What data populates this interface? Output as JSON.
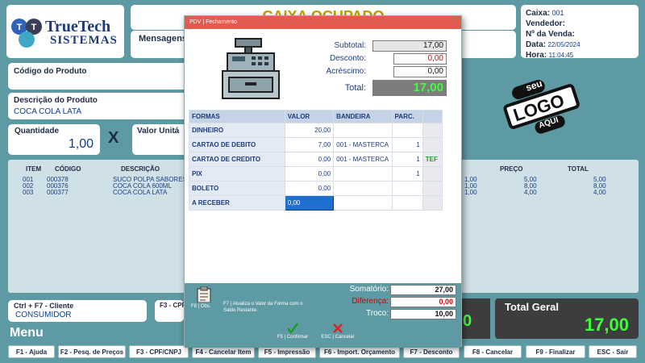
{
  "brand": {
    "name_top": "TrueTech",
    "name_bottom": "SISTEMAS"
  },
  "header": {
    "status": "CAIXA OCUPADO",
    "messages_label": "Mensagens"
  },
  "info": {
    "caixa_label": "Caixa:",
    "caixa_value": "001",
    "vendedor_label": "Vendedor:",
    "vendedor_value": "",
    "venda_label": "Nº da Venda:",
    "venda_value": "",
    "data_label": "Data:",
    "data_value": "22/05/2024",
    "hora_label": "Hora:",
    "hora_value": "11:04:45"
  },
  "product": {
    "codigo_label": "Código do Produto",
    "descricao_label": "Descrição do Produto",
    "descricao_value": "COCA COLA LATA",
    "quantidade_label": "Quantidade",
    "quantidade_value": "1,00",
    "x_symbol": "X",
    "valor_label": "Valor Unitá"
  },
  "logo_stamp": {
    "top": "seu",
    "middle": "LOGO",
    "bottom": "AQUI"
  },
  "sales_table": {
    "headers": {
      "item": "ITEM",
      "codigo": "CÓDIGO",
      "descricao": "DESCRIÇÃO",
      "preco": "PREÇO",
      "total": "TOTAL"
    },
    "rows": [
      {
        "item": "001",
        "codigo": "000378",
        "descricao": "SUCO POLPA SABORES",
        "qtd": "1,00",
        "preco": "5,00",
        "total": "5,00"
      },
      {
        "item": "002",
        "codigo": "000376",
        "descricao": "COCA COLA 600ML",
        "qtd": "1,00",
        "preco": "8,00",
        "total": "8,00"
      },
      {
        "item": "003",
        "codigo": "000377",
        "descricao": "COCA COLA LATA",
        "qtd": "1,00",
        "preco": "4,00",
        "total": "4,00"
      }
    ]
  },
  "client": {
    "label": "Ctrl + F7 - Cliente",
    "value": "CONSUMIDOR",
    "f3_label": "F3 - CPF"
  },
  "total_geral": {
    "label": "Total Geral",
    "value": "17,00",
    "left_partial": "0"
  },
  "menu": {
    "title": "Menu",
    "keys": [
      "F1 - Ajuda",
      "F2 - Pesq. de Preços",
      "F3 - CPF/CNPJ",
      "F4 - Cancelar Item",
      "F5 - Impressão",
      "F6 - Import. Orçamento",
      "F7 - Desconto",
      "F8 - Cancelar",
      "F9 - Finalizar",
      "ESC - Sair"
    ]
  },
  "modal": {
    "title": "PDV | Fechamento",
    "subtotal_label": "Subtotal:",
    "subtotal_value": "17,00",
    "desconto_label": "Desconto:",
    "desconto_value": "0,00",
    "acrescimo_label": "Acréscimo:",
    "acrescimo_value": "0,00",
    "total_label": "Total:",
    "total_value": "17,00",
    "pay_headers": {
      "formas": "FORMAS",
      "valor": "VALOR",
      "bandeira": "BANDEIRA",
      "parc": "PARC."
    },
    "payments": [
      {
        "forma": "DINHEIRO",
        "valor": "20,00",
        "bandeira": "",
        "parc": "",
        "extra": ""
      },
      {
        "forma": "CARTAO DE DEBITO",
        "valor": "7,00",
        "bandeira": "001 - MASTERCA",
        "parc": "1",
        "extra": ""
      },
      {
        "forma": "CARTAO DE CREDITO",
        "valor": "0,00",
        "bandeira": "001 - MASTERCA",
        "parc": "1",
        "extra": "TEF"
      },
      {
        "forma": "PIX",
        "valor": "0,00",
        "bandeira": "",
        "parc": "1",
        "extra": ""
      },
      {
        "forma": "BOLETO",
        "valor": "0,00",
        "bandeira": "",
        "parc": "",
        "extra": ""
      },
      {
        "forma": "A RECEBER",
        "valor": "0,00",
        "bandeira": "",
        "parc": "",
        "extra": ""
      }
    ],
    "f8_label": "F8 | Obs.",
    "f7_hint": "F7 | Atualiza o Valor da Forma com o Saldo Restante.",
    "somatorio_label": "Somatório:",
    "somatorio_value": "27,00",
    "diferenca_label": "Diferença:",
    "diferenca_value": "0,00",
    "troco_label": "Troco:",
    "troco_value": "10,00",
    "confirm_label": "F5 | Confirmar",
    "cancel_label": "ESC | Cancelar"
  },
  "colors": {
    "background": "#5e9aa3",
    "modal_title": "#e25b50",
    "total_green": "#3cff3c",
    "accent_blue": "#0d3f8a"
  }
}
